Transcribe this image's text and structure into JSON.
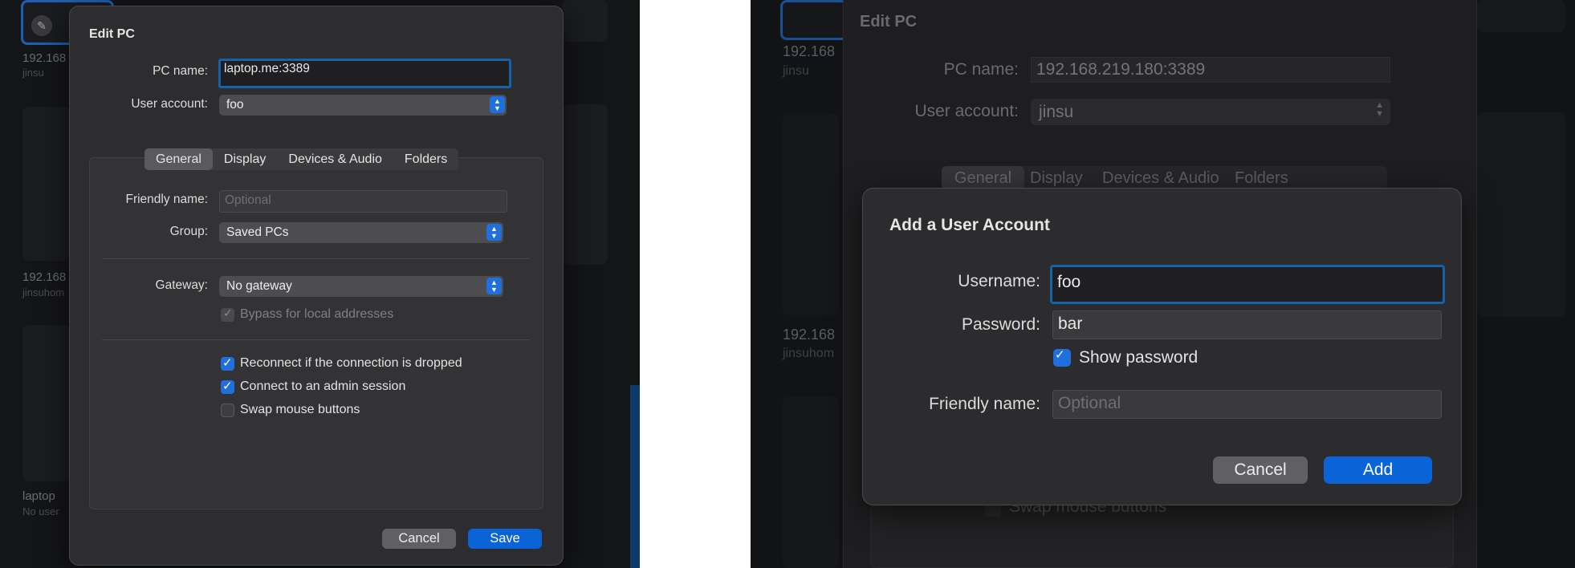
{
  "left": {
    "bg_tiles": {
      "t1_label": "192.168",
      "t1_sub": "jinsu",
      "t2_label": "192.168",
      "t2_sub": "jinsuhom",
      "t3_label": "laptop",
      "t3_sub": "No user"
    },
    "dialog": {
      "title": "Edit PC",
      "pc_name_label": "PC name:",
      "pc_name_value": "laptop.me:3389",
      "user_account_label": "User account:",
      "user_account_value": "foo",
      "tabs": [
        "General",
        "Display",
        "Devices & Audio",
        "Folders"
      ],
      "friendly_name_label": "Friendly name:",
      "friendly_name_placeholder": "Optional",
      "group_label": "Group:",
      "group_value": "Saved PCs",
      "gateway_label": "Gateway:",
      "gateway_value": "No gateway",
      "bypass_label": "Bypass for local addresses",
      "reconnect_label": "Reconnect if the connection is dropped",
      "admin_label": "Connect to an admin session",
      "swap_label": "Swap mouse buttons",
      "cancel": "Cancel",
      "save": "Save"
    }
  },
  "right": {
    "bg_tiles": {
      "t1_label": "192.168",
      "t1_sub": "jinsu",
      "t2_label": "192.168",
      "t2_sub": "jinsuhom"
    },
    "bg_dialog": {
      "title": "Edit PC",
      "pc_name_label": "PC name:",
      "pc_name_value": "192.168.219.180:3389",
      "user_account_label": "User account:",
      "user_account_value": "jinsu",
      "tabs": [
        "General",
        "Display",
        "Devices & Audio",
        "Folders"
      ],
      "swap_label": "Swap mouse buttons"
    },
    "sheet": {
      "title": "Add a User Account",
      "username_label": "Username:",
      "username_value": "foo",
      "password_label": "Password:",
      "password_value": "bar",
      "show_password_label": "Show password",
      "friendly_name_label": "Friendly name:",
      "friendly_name_placeholder": "Optional",
      "cancel": "Cancel",
      "add": "Add"
    }
  },
  "colors": {
    "accent_blue": "#0a64d8",
    "focus_ring": "#1463a8",
    "dialog_bg": "#2d2d2f"
  }
}
